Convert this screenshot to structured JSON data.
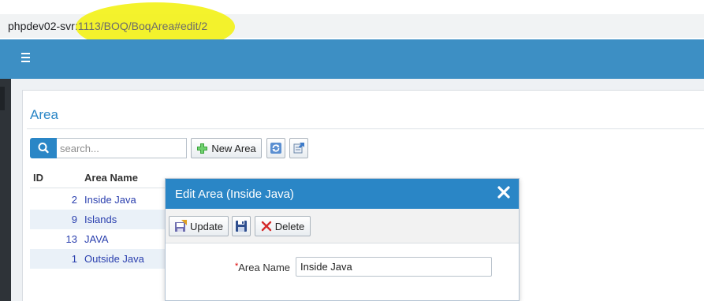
{
  "browser": {
    "url_host": "phpdev02-svr",
    "url_rest": ":1113/BOQ/BoqArea#edit/2"
  },
  "nav": {
    "menu_icon": "hamburger-icon"
  },
  "page": {
    "title": "Area"
  },
  "toolbar": {
    "search_placeholder": "search...",
    "search_icon": "search-icon",
    "new_label": "New Area",
    "new_icon": "plus-icon",
    "refresh_icon": "refresh-icon",
    "export_icon": "export-icon"
  },
  "grid": {
    "columns": [
      "ID",
      "Area Name"
    ],
    "rows": [
      {
        "id": "2",
        "name": "Inside Java"
      },
      {
        "id": "9",
        "name": "Islands"
      },
      {
        "id": "13",
        "name": "JAVA"
      },
      {
        "id": "1",
        "name": "Outside Java"
      }
    ]
  },
  "dialog": {
    "title": "Edit Area (Inside Java)",
    "close_icon": "close-icon",
    "update_label": "Update",
    "delete_label": "Delete",
    "required_mark": "*",
    "field_label": "Area Name",
    "field_value": "Inside Java"
  },
  "colors": {
    "accent": "#2a86c6",
    "navbar": "#3d8fc4",
    "highlight": "#f3f21a",
    "link": "#2a3fae"
  }
}
